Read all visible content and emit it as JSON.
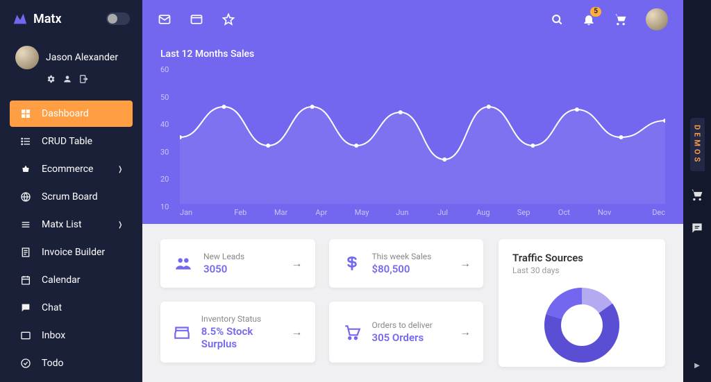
{
  "brand": {
    "name": "Matx"
  },
  "user": {
    "name": "Jason Alexander"
  },
  "nav": [
    {
      "label": "Dashboard",
      "active": true,
      "expandable": false
    },
    {
      "label": "CRUD Table",
      "active": false,
      "expandable": false
    },
    {
      "label": "Ecommerce",
      "active": false,
      "expandable": true
    },
    {
      "label": "Scrum Board",
      "active": false,
      "expandable": false
    },
    {
      "label": "Matx List",
      "active": false,
      "expandable": true
    },
    {
      "label": "Invoice Builder",
      "active": false,
      "expandable": false
    },
    {
      "label": "Calendar",
      "active": false,
      "expandable": false
    },
    {
      "label": "Chat",
      "active": false,
      "expandable": false
    },
    {
      "label": "Inbox",
      "active": false,
      "expandable": false
    },
    {
      "label": "Todo",
      "active": false,
      "expandable": false
    }
  ],
  "topbar": {
    "notification_count": "5"
  },
  "rail": {
    "demos_label": "DEMOS"
  },
  "chart_data": {
    "type": "line",
    "title": "Last 12 Months Sales",
    "categories": [
      "Jan",
      "Feb",
      "Mar",
      "Apr",
      "May",
      "Jun",
      "Jul",
      "Aug",
      "Sep",
      "Oct",
      "Nov",
      "Dec"
    ],
    "values": [
      34,
      45,
      31,
      45,
      31,
      43,
      26,
      45,
      31,
      44,
      34,
      40
    ],
    "ylim": [
      10,
      60
    ],
    "yticks": [
      60,
      50,
      40,
      30,
      20,
      10
    ],
    "xlabel": "",
    "ylabel": ""
  },
  "stats": [
    {
      "label": "New Leads",
      "value": "3050"
    },
    {
      "label": "This week Sales",
      "value": "$80,500"
    },
    {
      "label": "Inventory Status",
      "value": "8.5% Stock Surplus"
    },
    {
      "label": "Orders to deliver",
      "value": "305 Orders"
    }
  ],
  "traffic": {
    "title": "Traffic Sources",
    "subtitle": "Last 30 days"
  }
}
